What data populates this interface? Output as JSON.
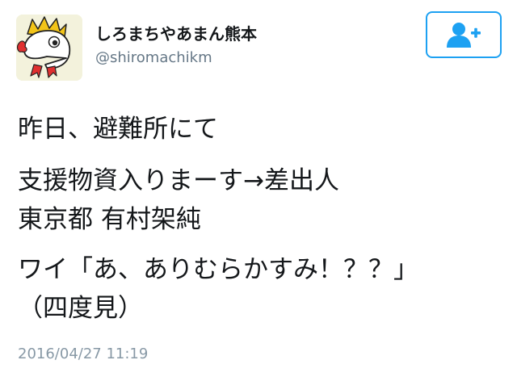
{
  "user": {
    "display_name": "しろまちやあまん熊本",
    "screen_name": "@shiromachikm",
    "avatar": "cartoon-character-avatar"
  },
  "follow_button": {
    "icon": "add-user-icon",
    "color": "#1da1f2"
  },
  "tweet": {
    "lines": [
      "昨日、避難所にて",
      "支援物資入りまーす→差出人",
      "東京都 有村架純",
      "ワイ「あ、ありむらかすみ！？？」",
      "（四度見）"
    ],
    "timestamp": "2016/04/27 11:19"
  },
  "colors": {
    "text": "#14171a",
    "secondary": "#657786",
    "timestamp": "#8899a6",
    "accent": "#1da1f2"
  }
}
